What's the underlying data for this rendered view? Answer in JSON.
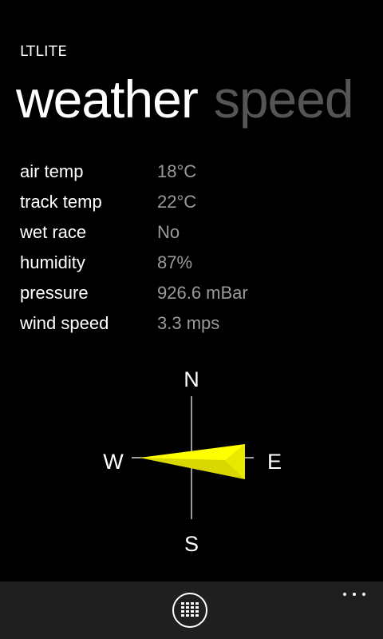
{
  "app": {
    "title": "LTLITE"
  },
  "pivot": {
    "items": [
      {
        "label": "weather",
        "active": true
      },
      {
        "label": "speed",
        "active": false
      }
    ]
  },
  "weather": {
    "rows": [
      {
        "label": "air temp",
        "value": "18°C"
      },
      {
        "label": "track temp",
        "value": "22°C"
      },
      {
        "label": "wet race",
        "value": "No"
      },
      {
        "label": "humidity",
        "value": "87%"
      },
      {
        "label": "pressure",
        "value": "926.6 mBar"
      },
      {
        "label": "wind speed",
        "value": "3.3 mps"
      }
    ]
  },
  "compass": {
    "north": "N",
    "south": "S",
    "east": "E",
    "west": "W",
    "arrow_color": "#ffff00",
    "arrow_shade_color": "#d8d800",
    "pointing": "E"
  },
  "appbar": {
    "button_icon": "grid-list-icon",
    "more_icon": "ellipsis-icon"
  },
  "colors": {
    "background": "#000000",
    "text_primary": "#ffffff",
    "text_secondary": "#9a9a9a",
    "pivot_inactive": "#555555",
    "appbar": "#1f1f1f"
  }
}
